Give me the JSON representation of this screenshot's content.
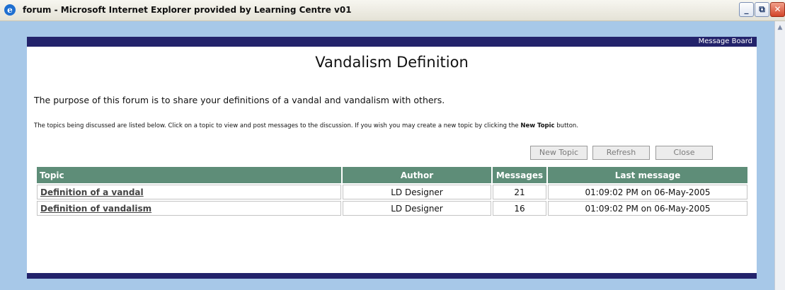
{
  "window": {
    "title": "forum - Microsoft Internet Explorer provided by Learning Centre v01",
    "app_icon": "ie-icon",
    "controls": {
      "minimize": "_",
      "maximize": "⧉",
      "close": "✕"
    }
  },
  "page": {
    "topbar_label": "Message Board",
    "heading": "Vandalism Definition",
    "intro": "The purpose of this forum is to share your definitions of a vandal and vandalism with others.",
    "instructions_prefix": "The topics being discussed are listed below. Click on a topic to view and post messages to the discussion. If you wish you may create a new topic by clicking the ",
    "instructions_bold": "New Topic",
    "instructions_suffix": " button.",
    "buttons": {
      "new_topic": "New Topic",
      "refresh": "Refresh",
      "close": "Close"
    },
    "table": {
      "headers": {
        "topic": "Topic",
        "author": "Author",
        "messages": "Messages",
        "last_message": "Last message"
      },
      "rows": [
        {
          "topic": "Definition of a vandal",
          "author": "LD Designer",
          "messages": "21",
          "last_message": "01:09:02 PM on 06-May-2005"
        },
        {
          "topic": "Definition of vandalism",
          "author": "LD Designer",
          "messages": "16",
          "last_message": "01:09:02 PM on 06-May-2005"
        }
      ]
    }
  },
  "colors": {
    "header_bar": "#23236b",
    "table_header": "#5e8d78",
    "window_frame": "#a7c8e8"
  }
}
